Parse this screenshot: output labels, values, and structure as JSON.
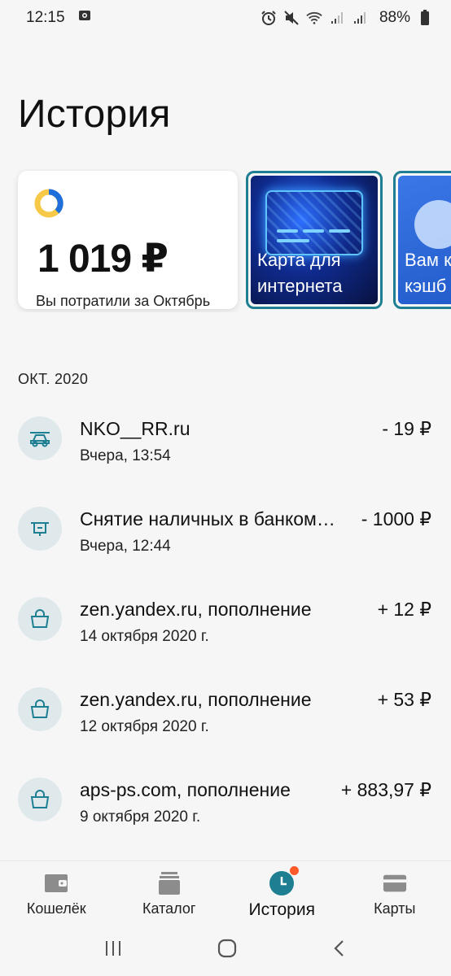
{
  "status_bar": {
    "time": "12:15",
    "battery": "88%",
    "icons": [
      "camera-icon",
      "alarm-icon",
      "mute-icon",
      "wifi-icon",
      "signal-icon",
      "signal-icon-2",
      "battery-icon"
    ]
  },
  "header": {
    "title": "История"
  },
  "summary_card": {
    "amount": "1 019 ₽",
    "caption": "Вы потратили за Октябрь"
  },
  "promo_cards": [
    {
      "label_line1": "Карта для",
      "label_line2": "интернета"
    },
    {
      "label_line1": "Вам к",
      "label_line2": "кэшб"
    }
  ],
  "section": {
    "title": "ОКТ. 2020"
  },
  "transactions": [
    {
      "name": "NKO__RR.ru",
      "date": "Вчера, 13:54",
      "amount": "- 19 ₽",
      "icon": "car-icon"
    },
    {
      "name": "Снятие наличных в банкомате",
      "date": "Вчера, 12:44",
      "amount": "- 1000 ₽",
      "icon": "atm-icon"
    },
    {
      "name": "zen.yandex.ru, пополнение",
      "date": "14 октября 2020 г.",
      "amount": "+ 12 ₽",
      "icon": "bag-icon"
    },
    {
      "name": "zen.yandex.ru, пополнение",
      "date": "12 октября 2020 г.",
      "amount": "+ 53 ₽",
      "icon": "bag-icon"
    },
    {
      "name": "aps-ps.com, пополнение",
      "date": "9 октября 2020 г.",
      "amount": "+ 883,97 ₽",
      "icon": "bag-icon"
    }
  ],
  "bottom_nav": {
    "items": [
      {
        "label": "Кошелёк",
        "icon": "wallet-icon"
      },
      {
        "label": "Каталог",
        "icon": "catalog-icon"
      },
      {
        "label": "История",
        "icon": "clock-icon",
        "active": true
      },
      {
        "label": "Карты",
        "icon": "card-icon"
      }
    ]
  },
  "colors": {
    "accent": "#1e7f93",
    "notification_dot": "#ff5a2a",
    "icon_bg": "#dfe9ec",
    "donut_yellow": "#f7c948",
    "donut_blue": "#1e6fd9"
  }
}
